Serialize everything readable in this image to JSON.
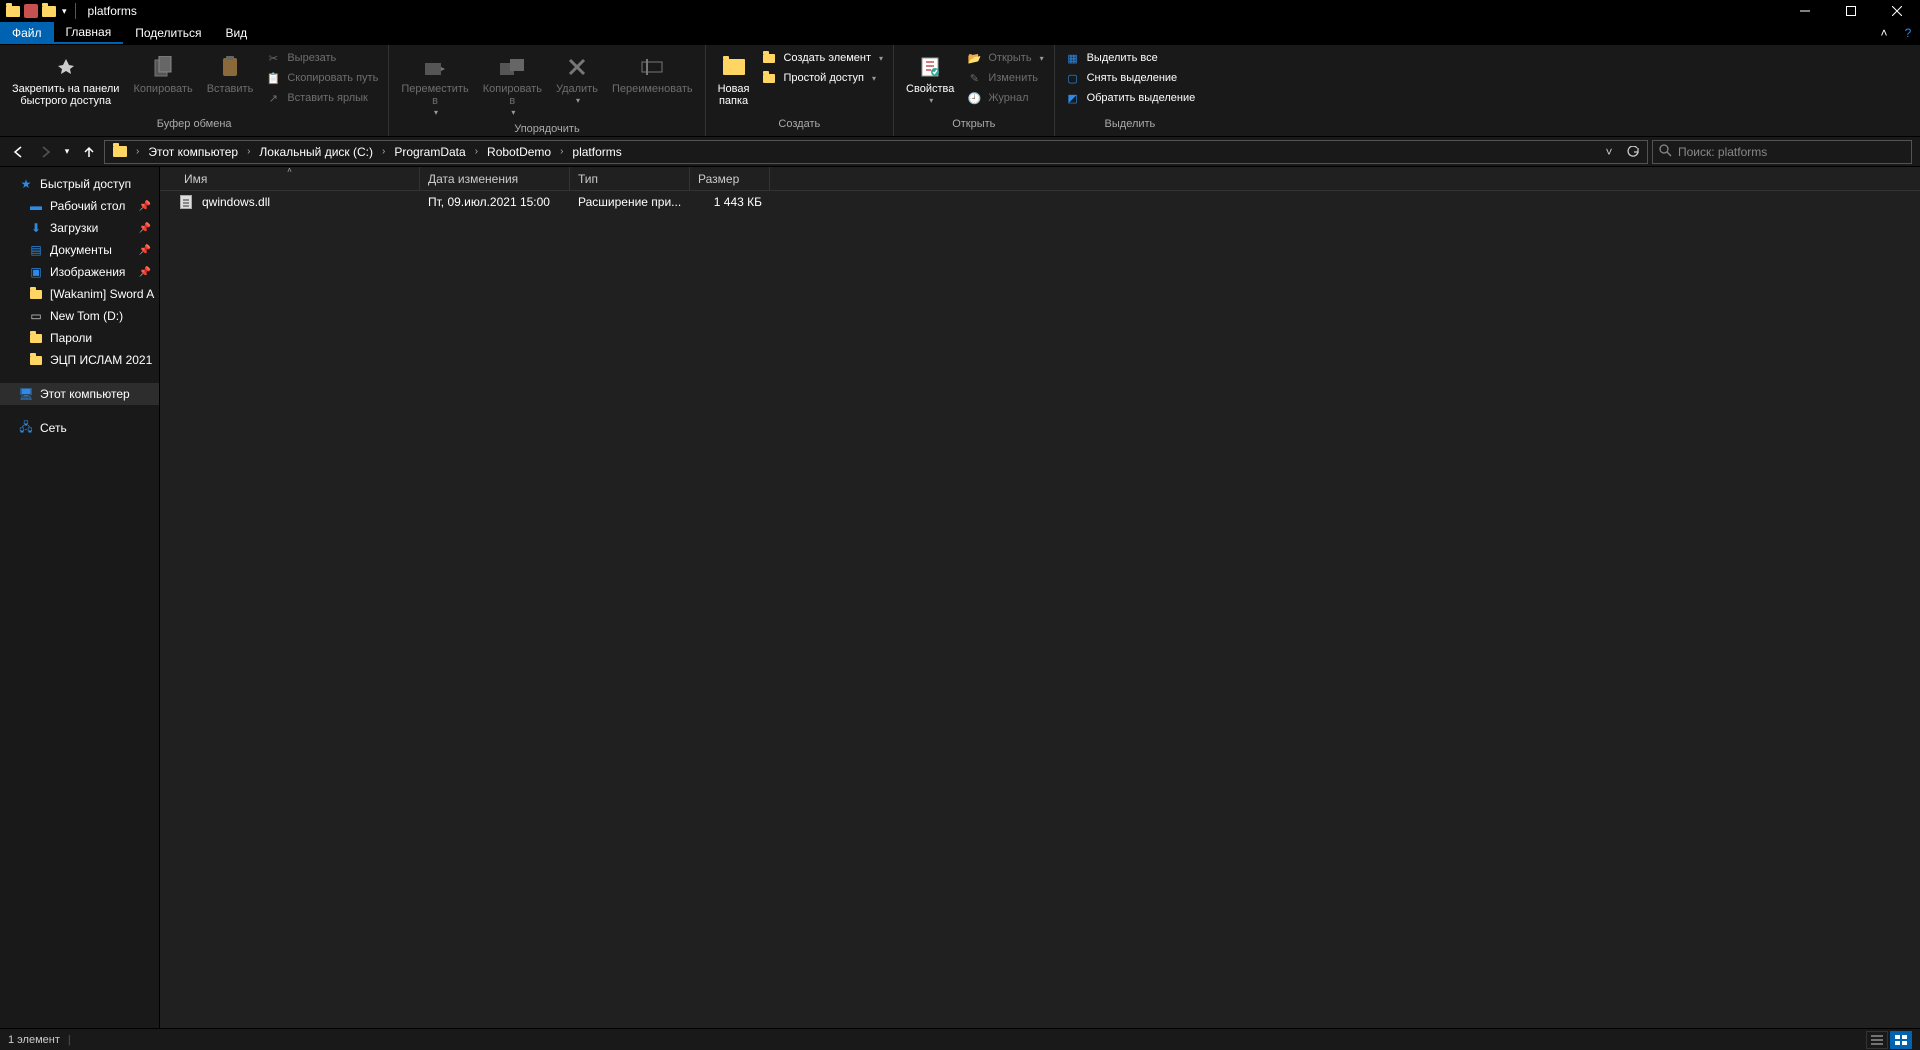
{
  "window": {
    "title": "platforms"
  },
  "tabs": {
    "file": "Файл",
    "home": "Главная",
    "share": "Поделиться",
    "view": "Вид"
  },
  "ribbon": {
    "clipboard": {
      "pin": "Закрепить на панели\nбыстрого доступа",
      "copy": "Копировать",
      "paste": "Вставить",
      "cut": "Вырезать",
      "copy_path": "Скопировать путь",
      "paste_shortcut": "Вставить ярлык",
      "group": "Буфер обмена"
    },
    "organize": {
      "move_to": "Переместить\nв",
      "copy_to": "Копировать\nв",
      "delete": "Удалить",
      "rename": "Переименовать",
      "group": "Упорядочить"
    },
    "new": {
      "new_folder": "Новая\nпапка",
      "new_item": "Создать элемент",
      "easy_access": "Простой доступ",
      "group": "Создать"
    },
    "open": {
      "properties": "Свойства",
      "open": "Открыть",
      "edit": "Изменить",
      "history": "Журнал",
      "group": "Открыть"
    },
    "select": {
      "select_all": "Выделить все",
      "select_none": "Снять выделение",
      "invert": "Обратить выделение",
      "group": "Выделить"
    }
  },
  "breadcrumbs": [
    "Этот компьютер",
    "Локальный диск (C:)",
    "ProgramData",
    "RobotDemo",
    "platforms"
  ],
  "search": {
    "placeholder": "Поиск: platforms"
  },
  "nav_pane": {
    "quick_access": "Быстрый доступ",
    "desktop": "Рабочий стол",
    "downloads": "Загрузки",
    "documents": "Документы",
    "pictures": "Изображения",
    "wakanim": "[Wakanim] Sword A",
    "newtom": "New Tom (D:)",
    "passwords": "Пароли",
    "ecp": "ЭЦП ИСЛАМ 2021",
    "this_pc": "Этот компьютер",
    "network": "Сеть"
  },
  "columns": {
    "name": "Имя",
    "date": "Дата изменения",
    "type": "Тип",
    "size": "Размер"
  },
  "files": [
    {
      "name": "qwindows.dll",
      "date": "Пт, 09.июл.2021 15:00",
      "type": "Расширение при...",
      "size": "1 443 КБ"
    }
  ],
  "status": {
    "count": "1 элемент"
  }
}
